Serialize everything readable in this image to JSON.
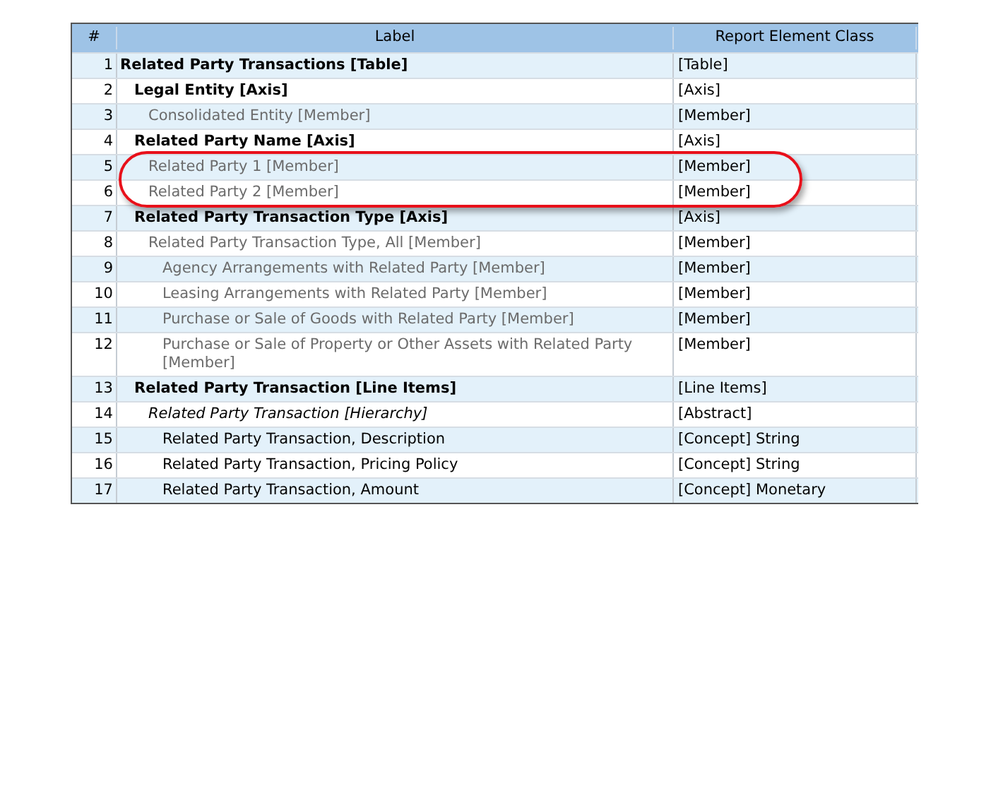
{
  "table": {
    "columns": [
      "#",
      "Label",
      "Report Element Class"
    ],
    "rows": [
      {
        "number": "1",
        "label": "Related Party Transactions [Table]",
        "kind": "table",
        "class": "[Table]",
        "circled": false,
        "children": [
          {
            "number": "2",
            "label": "Legal Entity [Axis]",
            "kind": "axis",
            "class": "[Axis]",
            "circled": false,
            "children": [
              {
                "number": "3",
                "label": "Consolidated Entity [Member]",
                "kind": "member",
                "class": "[Member]",
                "circled": false
              }
            ]
          },
          {
            "number": "4",
            "label": "Related Party Name [Axis]",
            "kind": "axis",
            "class": "[Axis]",
            "circled": false,
            "children": [
              {
                "number": "5",
                "label": "Related Party 1 [Member]",
                "kind": "member",
                "class": "[Member]",
                "circled": true
              },
              {
                "number": "6",
                "label": "Related Party 2 [Member]",
                "kind": "member",
                "class": "[Member]",
                "circled": true
              }
            ]
          },
          {
            "number": "7",
            "label": "Related Party Transaction Type [Axis]",
            "kind": "axis",
            "class": "[Axis]",
            "circled": false,
            "children": [
              {
                "number": "8",
                "label": "Related Party Transaction Type, All [Member]",
                "kind": "member",
                "class": "[Member]",
                "circled": false,
                "children": [
                  {
                    "number": "9",
                    "label": "Agency Arrangements with Related Party [Member]",
                    "kind": "member",
                    "class": "[Member]",
                    "circled": false
                  },
                  {
                    "number": "10",
                    "label": "Leasing Arrangements with Related Party [Member]",
                    "kind": "member",
                    "class": "[Member]",
                    "circled": false
                  },
                  {
                    "number": "11",
                    "label": "Purchase or Sale of Goods with Related Party [Member]",
                    "kind": "member",
                    "class": "[Member]",
                    "circled": false
                  },
                  {
                    "number": "12",
                    "label": "Purchase or Sale of Property or Other Assets with Related Party [Member]",
                    "kind": "member",
                    "class": "[Member]",
                    "circled": false
                  }
                ]
              }
            ]
          },
          {
            "number": "13",
            "label": "Related Party Transaction [Line Items]",
            "kind": "axis",
            "class": "[Line Items]",
            "circled": false,
            "children": [
              {
                "number": "14",
                "label": "Related Party Transaction [Hierarchy]",
                "kind": "abstract",
                "class": "[Abstract]",
                "circled": false,
                "children": [
                  {
                    "number": "15",
                    "label": "Related Party Transaction, Description",
                    "kind": "concept",
                    "class": "[Concept] String",
                    "circled": false
                  },
                  {
                    "number": "16",
                    "label": "Related Party Transaction, Pricing Policy",
                    "kind": "concept",
                    "class": "[Concept] String",
                    "circled": false
                  },
                  {
                    "number": "17",
                    "label": "Related Party Transaction, Amount",
                    "kind": "concept",
                    "class": "[Concept] Monetary",
                    "circled": false
                  }
                ]
              }
            ]
          }
        ]
      }
    ]
  }
}
